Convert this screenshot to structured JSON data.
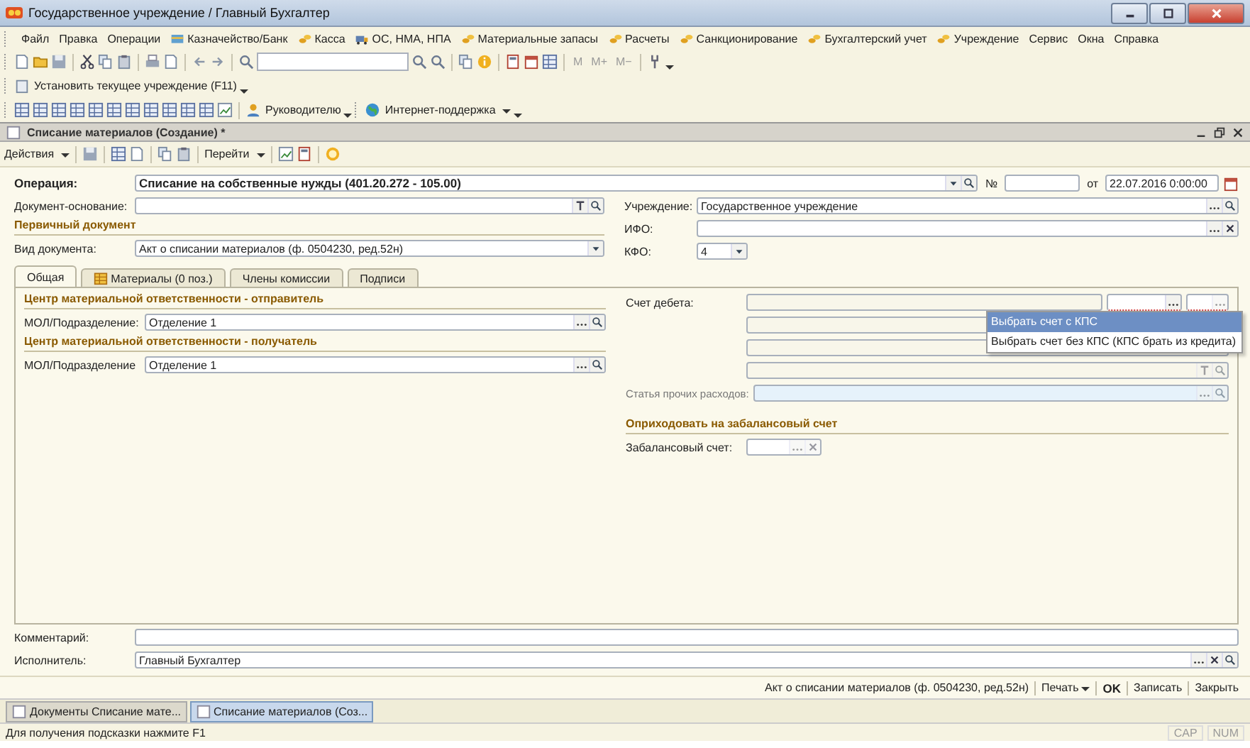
{
  "window": {
    "title": "Государственное учреждение / Главный Бухгалтер"
  },
  "menu": [
    {
      "label": "Файл",
      "kind": "text"
    },
    {
      "label": "Правка",
      "kind": "text"
    },
    {
      "label": "Операции",
      "kind": "text"
    },
    {
      "label": "Казначейство/Банк",
      "kind": "icon"
    },
    {
      "label": "Касса",
      "kind": "icon"
    },
    {
      "label": "ОС, НМА, НПА",
      "kind": "icon"
    },
    {
      "label": "Материальные запасы",
      "kind": "icon"
    },
    {
      "label": "Расчеты",
      "kind": "icon"
    },
    {
      "label": "Санкционирование",
      "kind": "icon"
    },
    {
      "label": "Бухгалтерский учет",
      "kind": "icon"
    },
    {
      "label": "Учреждение",
      "kind": "icon"
    },
    {
      "label": "Сервис",
      "kind": "text"
    },
    {
      "label": "Окна",
      "kind": "text"
    },
    {
      "label": "Справка",
      "kind": "text"
    }
  ],
  "memory_keys": [
    "M",
    "M+",
    "M−"
  ],
  "institution_button": "Установить текущее учреждение (F11)",
  "panel_buttons": [
    "Руководителю",
    "Интернет-поддержка"
  ],
  "document": {
    "title": "Списание материалов (Создание) *",
    "actions": "Действия",
    "goto": "Перейти"
  },
  "form": {
    "operation": {
      "label": "Операция:",
      "value": "Списание на собственные нужды (401.20.272 - 105.00)"
    },
    "number_label": "№",
    "date": {
      "label": "от",
      "value": "22.07.2016 0:00:00"
    },
    "basis_label": "Документ-основание:",
    "primary_section": "Первичный документ",
    "doc_type": {
      "label": "Вид документа:",
      "value": "Акт о списании материалов (ф. 0504230, ред.52н)"
    },
    "institution": {
      "label": "Учреждение:",
      "value": "Государственное учреждение"
    },
    "ifo_label": "ИФО:",
    "kfo": {
      "label": "КФО:",
      "value": "4"
    }
  },
  "tabs": [
    {
      "label": "Общая",
      "kind": "text",
      "selected": true
    },
    {
      "label": "Материалы (0 поз.)",
      "kind": "icon",
      "selected": false
    },
    {
      "label": "Члены комиссии",
      "kind": "text",
      "selected": false
    },
    {
      "label": "Подписи",
      "kind": "text",
      "selected": false
    }
  ],
  "general": {
    "sender_section": "Центр материальной ответственности - отправитель",
    "sender": {
      "label": "МОЛ/Подразделение:",
      "value": "Отделение 1"
    },
    "receiver_section": "Центр материальной ответственности - получатель",
    "receiver": {
      "label": "МОЛ/Подразделение",
      "value": "Отделение 1"
    },
    "debit_label": "Счет дебета:",
    "debit_menu": [
      {
        "label": "Выбрать счет с КПС",
        "selected": true
      },
      {
        "label": "Выбрать счет без КПС (КПС брать из кредита)",
        "selected": false
      }
    ],
    "expense": {
      "label": "Статья прочих расходов:",
      "disabled": true
    },
    "offbalance_section": "Оприходовать на забалансовый счет",
    "offbalance_label": "Забалансовый счет:"
  },
  "comment_label": "Комментарий:",
  "executor": {
    "label": "Исполнитель:",
    "value": "Главный Бухгалтер"
  },
  "footer": [
    {
      "label": "Акт о списании материалов (ф. 0504230, ред.52н)",
      "kind": "plain"
    },
    {
      "label": "Печать",
      "kind": "menu"
    },
    {
      "label": "OK",
      "kind": "default"
    },
    {
      "label": "Записать",
      "kind": "plain"
    },
    {
      "label": "Закрыть",
      "kind": "plain"
    }
  ],
  "taskbar": [
    {
      "label": "Документы Списание мате...",
      "selected": false
    },
    {
      "label": "Списание материалов (Соз...",
      "selected": true
    }
  ],
  "status_bar": {
    "hint": "Для получения подсказки нажмите F1",
    "indicators": [
      "CAP",
      "NUM"
    ]
  }
}
